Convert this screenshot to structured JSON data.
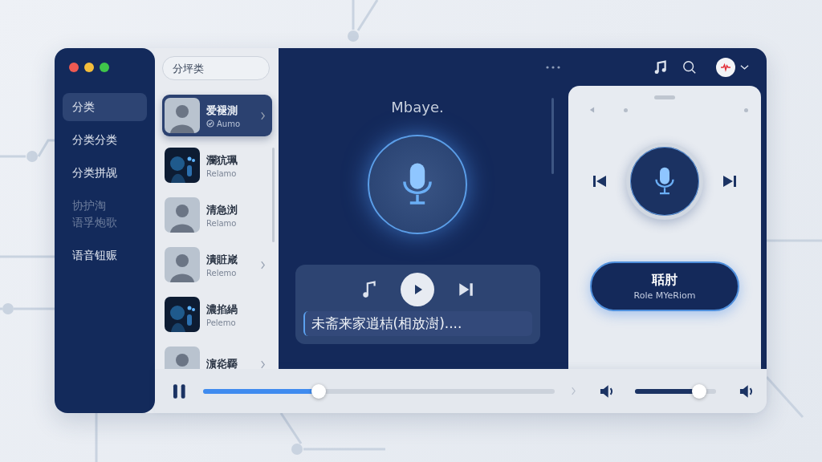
{
  "window": {
    "traffic_lights": [
      {
        "color": "#ee5a52"
      },
      {
        "color": "#f3bd3b"
      },
      {
        "color": "#3fc54a"
      }
    ]
  },
  "sidebar": {
    "items": [
      {
        "label": "分类",
        "selected": true,
        "disabled": false
      },
      {
        "label": "分类分类",
        "selected": false,
        "disabled": false
      },
      {
        "label": "分类拼觇",
        "selected": false,
        "disabled": false
      },
      {
        "label": "协护淘",
        "label_2": "语孚炮歌",
        "selected": false,
        "disabled": true
      },
      {
        "label": "语音钮赈",
        "selected": false,
        "disabled": false
      }
    ]
  },
  "search": {
    "placeholder": "分坪类"
  },
  "list": {
    "items": [
      {
        "kind": "avatar",
        "title": "爱褪測",
        "subtitle": "Aumo",
        "verified": true,
        "chevron": true,
        "selected": true
      },
      {
        "kind": "picture",
        "title": "瀾犺珮",
        "subtitle": "Relamo",
        "chevron": false,
        "selected": false
      },
      {
        "kind": "avatar",
        "title": "清急浏",
        "subtitle": "Relamo",
        "chevron": false,
        "selected": false
      },
      {
        "kind": "avatar",
        "title": "潰賍嵅",
        "subtitle": "Relemo",
        "chevron": true,
        "selected": false
      },
      {
        "kind": "picture",
        "title": "濃掐緺",
        "subtitle": "Pelemo",
        "chevron": false,
        "selected": false
      },
      {
        "kind": "avatar",
        "title": "濵炛覉",
        "chevron": true,
        "selected": false
      }
    ]
  },
  "main": {
    "brand": "Mbaye.",
    "now_playing": "未斋来家逍桔(相放澍)...."
  },
  "card": {
    "button_title": "聒肘",
    "button_subtitle": "Role MYeRiom"
  },
  "player": {
    "progress": {
      "level": 0.33
    },
    "volume": {
      "level": 0.8
    }
  }
}
